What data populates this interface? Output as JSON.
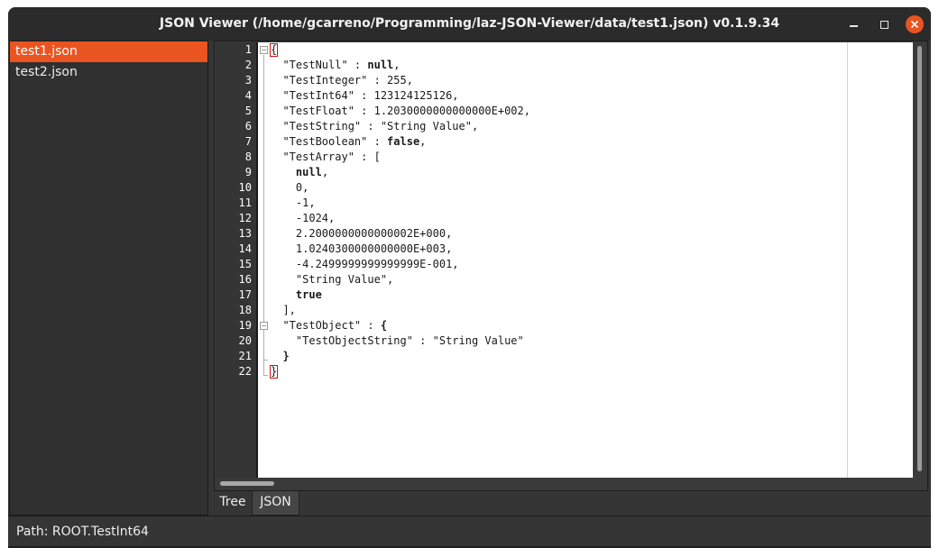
{
  "window": {
    "title": "JSON Viewer (/home/gcarreno/Programming/laz-JSON-Viewer/data/test1.json) v0.1.9.34"
  },
  "files": [
    {
      "label": "test1.json",
      "selected": true
    },
    {
      "label": "test2.json",
      "selected": false
    }
  ],
  "editor": {
    "line_numbers": [
      "1",
      "2",
      "3",
      "4",
      "5",
      "6",
      "7",
      "8",
      "9",
      "10",
      "11",
      "12",
      "13",
      "14",
      "15",
      "16",
      "17",
      "18",
      "19",
      "20",
      "21",
      "22"
    ]
  },
  "tabs": {
    "tree_label": "Tree",
    "json_label": "JSON",
    "active": "JSON"
  },
  "status": {
    "path_text": "Path: ROOT.TestInt64"
  },
  "colors": {
    "accent": "#e95420",
    "brace_highlight": "#d01010"
  }
}
